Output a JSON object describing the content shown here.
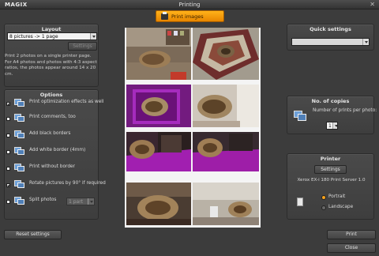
{
  "app": {
    "logo": "MAGIX",
    "window_title": "Printing"
  },
  "tab": {
    "label": "Print images"
  },
  "layout": {
    "title": "Layout",
    "selected": "8 pictures -> 1 page",
    "settings_label": "Settings",
    "description": "Print 2 photos on a single printer page. For A4 photos and photos with 4:3 aspect ratios, the photos appear around 14 x 20 cm."
  },
  "options": {
    "title": "Options",
    "items": [
      {
        "label": "Print optimization effects as well",
        "checked": true
      },
      {
        "label": "Print comments, too",
        "checked": false
      },
      {
        "label": "Add black borders",
        "checked": false
      },
      {
        "label": "Add white border (4mm)",
        "checked": false
      },
      {
        "label": "Print without border",
        "checked": false
      },
      {
        "label": "Rotate pictures by 90° if required",
        "checked": true
      },
      {
        "label": "Split photos",
        "checked": false
      }
    ],
    "split_value": "1 part"
  },
  "quick_settings": {
    "title": "Quick settings",
    "value": ""
  },
  "copies": {
    "title": "No. of copies",
    "label": "Number of prints per photo:",
    "value": "1"
  },
  "printer": {
    "title": "Printer",
    "settings_label": "Settings",
    "name": "Xerox EX-i 180 Print Server 1.0",
    "orientation_options": [
      "Portrait",
      "Landscape"
    ],
    "selected_orientation": "Portrait"
  },
  "footer": {
    "reset_label": "Reset settings",
    "print_label": "Print",
    "close_label": "Close"
  },
  "colors": {
    "accent": "#f7a21b",
    "background": "#3c3c3c"
  }
}
